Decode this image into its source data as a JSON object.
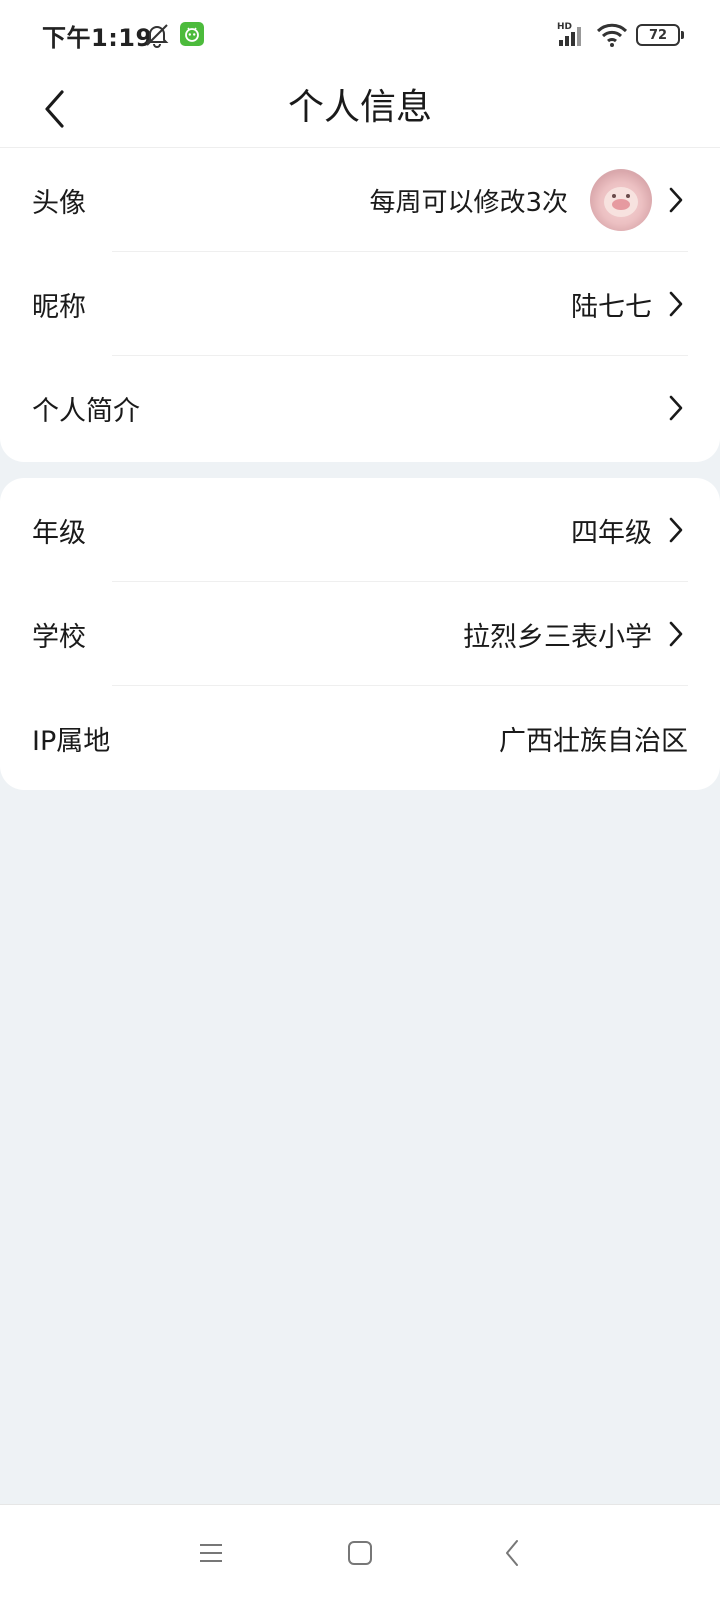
{
  "status_bar": {
    "time": "下午1:19",
    "battery": "72",
    "icons": [
      "mute-bell-icon",
      "app-notification-icon",
      "hd-signal-icon",
      "wifi-icon",
      "battery-icon"
    ]
  },
  "header": {
    "title": "个人信息",
    "back_icon": "chevron-left-icon"
  },
  "profile_card": {
    "rows": [
      {
        "label": "头像",
        "hint": "每周可以修改3次",
        "has_avatar": true,
        "chevron": true
      },
      {
        "label": "昵称",
        "value": "陆七七",
        "chevron": true
      },
      {
        "label": "个人简介",
        "value": "",
        "chevron": true
      }
    ]
  },
  "school_card": {
    "rows": [
      {
        "label": "年级",
        "value": "四年级",
        "chevron": true
      },
      {
        "label": "学校",
        "value": "拉烈乡三表小学",
        "chevron": true
      },
      {
        "label": "IP属地",
        "value": "广西壮族自治区",
        "chevron": false
      }
    ]
  },
  "nav_bar": {
    "icons": [
      "menu-icon",
      "home-icon",
      "back-icon"
    ]
  },
  "colors": {
    "page_background": "#eef2f5",
    "card_background": "#ffffff",
    "text": "#1a1a1a",
    "app_icon_green": "#4cbb3c"
  }
}
